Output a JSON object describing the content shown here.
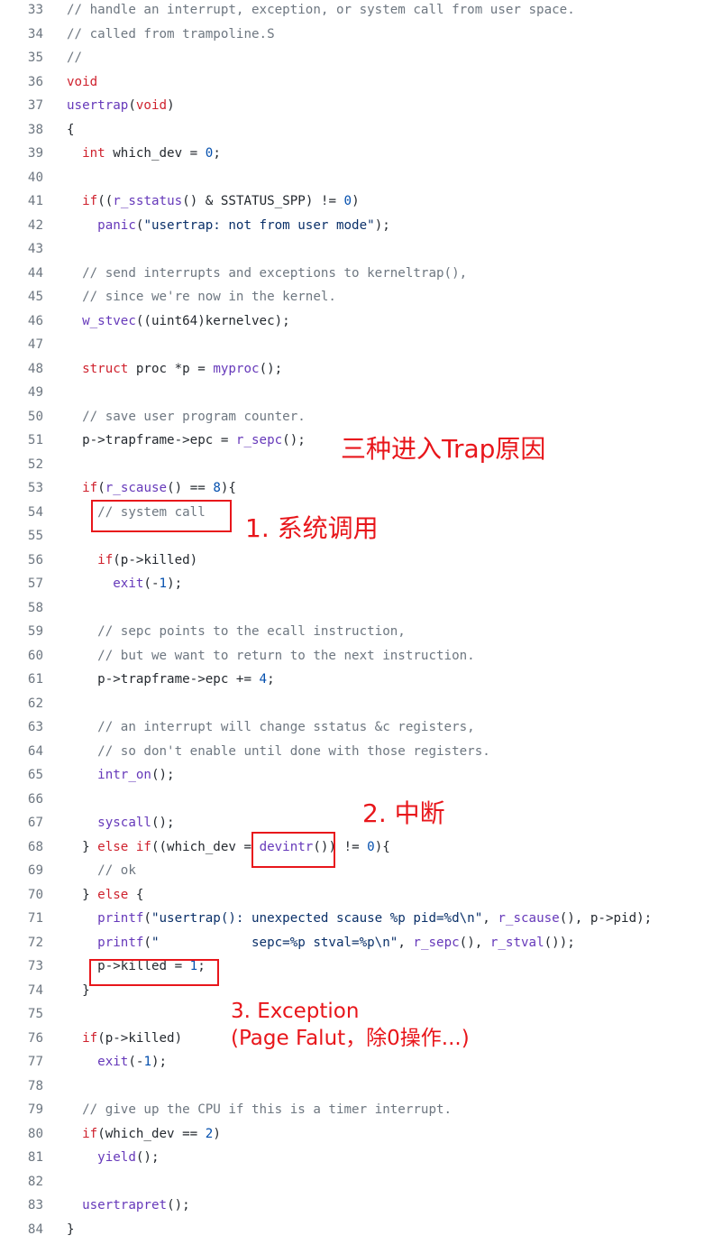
{
  "code": {
    "lines": [
      {
        "n": "33",
        "html": "<span class='cm'>// handle an interrupt, exception, or system call from user space.</span>"
      },
      {
        "n": "34",
        "html": "<span class='cm'>// called from trampoline.S</span>"
      },
      {
        "n": "35",
        "html": "<span class='cm'>//</span>"
      },
      {
        "n": "36",
        "html": "<span class='kw'>void</span>"
      },
      {
        "n": "37",
        "html": "<span class='fn'>usertrap</span>(<span class='kw'>void</span>)"
      },
      {
        "n": "38",
        "html": "{"
      },
      {
        "n": "39",
        "html": "  <span class='kw'>int</span> which_dev = <span class='nm'>0</span>;"
      },
      {
        "n": "40",
        "html": ""
      },
      {
        "n": "41",
        "html": "  <span class='kw'>if</span>((<span class='fn'>r_sstatus</span>() &amp; SSTATUS_SPP) != <span class='nm'>0</span>)"
      },
      {
        "n": "42",
        "html": "    <span class='fn'>panic</span>(<span class='st'>\"usertrap: not from user mode\"</span>);"
      },
      {
        "n": "43",
        "html": ""
      },
      {
        "n": "44",
        "html": "  <span class='cm'>// send interrupts and exceptions to kerneltrap(),</span>"
      },
      {
        "n": "45",
        "html": "  <span class='cm'>// since we're now in the kernel.</span>"
      },
      {
        "n": "46",
        "html": "  <span class='fn'>w_stvec</span>((uint64)kernelvec);"
      },
      {
        "n": "47",
        "html": ""
      },
      {
        "n": "48",
        "html": "  <span class='kw'>struct</span> proc *p = <span class='fn'>myproc</span>();"
      },
      {
        "n": "49",
        "html": ""
      },
      {
        "n": "50",
        "html": "  <span class='cm'>// save user program counter.</span>"
      },
      {
        "n": "51",
        "html": "  p-&gt;trapframe-&gt;epc = <span class='fn'>r_sepc</span>();"
      },
      {
        "n": "52",
        "html": ""
      },
      {
        "n": "53",
        "html": "  <span class='kw'>if</span>(<span class='fn'>r_scause</span>() == <span class='nm'>8</span>){"
      },
      {
        "n": "54",
        "html": "    <span class='cm'>// system call</span>"
      },
      {
        "n": "55",
        "html": ""
      },
      {
        "n": "56",
        "html": "    <span class='kw'>if</span>(p-&gt;killed)"
      },
      {
        "n": "57",
        "html": "      <span class='fn'>exit</span>(-<span class='nm'>1</span>);"
      },
      {
        "n": "58",
        "html": ""
      },
      {
        "n": "59",
        "html": "    <span class='cm'>// sepc points to the ecall instruction,</span>"
      },
      {
        "n": "60",
        "html": "    <span class='cm'>// but we want to return to the next instruction.</span>"
      },
      {
        "n": "61",
        "html": "    p-&gt;trapframe-&gt;epc += <span class='nm'>4</span>;"
      },
      {
        "n": "62",
        "html": ""
      },
      {
        "n": "63",
        "html": "    <span class='cm'>// an interrupt will change sstatus &amp;c registers,</span>"
      },
      {
        "n": "64",
        "html": "    <span class='cm'>// so don't enable until done with those registers.</span>"
      },
      {
        "n": "65",
        "html": "    <span class='fn'>intr_on</span>();"
      },
      {
        "n": "66",
        "html": ""
      },
      {
        "n": "67",
        "html": "    <span class='fn'>syscall</span>();"
      },
      {
        "n": "68",
        "html": "  } <span class='kw'>else if</span>((which_dev = <span class='fn'>devintr</span>()) != <span class='nm'>0</span>){"
      },
      {
        "n": "69",
        "html": "    <span class='cm'>// ok</span>"
      },
      {
        "n": "70",
        "html": "  } <span class='kw'>else</span> {"
      },
      {
        "n": "71",
        "html": "    <span class='fn'>printf</span>(<span class='st'>\"usertrap(): unexpected scause %p pid=%d\\n\"</span>, <span class='fn'>r_scause</span>(), p-&gt;pid);"
      },
      {
        "n": "72",
        "html": "    <span class='fn'>printf</span>(<span class='st'>\"            sepc=%p stval=%p\\n\"</span>, <span class='fn'>r_sepc</span>(), <span class='fn'>r_stval</span>());"
      },
      {
        "n": "73",
        "html": "    p-&gt;killed = <span class='nm'>1</span>;"
      },
      {
        "n": "74",
        "html": "  }"
      },
      {
        "n": "75",
        "html": ""
      },
      {
        "n": "76",
        "html": "  <span class='kw'>if</span>(p-&gt;killed)"
      },
      {
        "n": "77",
        "html": "    <span class='fn'>exit</span>(-<span class='nm'>1</span>);"
      },
      {
        "n": "78",
        "html": ""
      },
      {
        "n": "79",
        "html": "  <span class='cm'>// give up the CPU if this is a timer interrupt.</span>"
      },
      {
        "n": "80",
        "html": "  <span class='kw'>if</span>(which_dev == <span class='nm'>2</span>)"
      },
      {
        "n": "81",
        "html": "    <span class='fn'>yield</span>();"
      },
      {
        "n": "82",
        "html": ""
      },
      {
        "n": "83",
        "html": "  <span class='fn'>usertrapret</span>();"
      },
      {
        "n": "84",
        "html": "}"
      }
    ]
  },
  "annotations": {
    "title": "三种进入Trap原因",
    "syscall": "1. 系统调用",
    "interrupt": "2. 中断",
    "exception_line1": "3. Exception",
    "exception_line2": "(Page Falut，除0操作...)"
  },
  "colors": {
    "annotation_red": "#e8161b",
    "keyword": "#cf222e",
    "function": "#6639ba",
    "number": "#0550ae",
    "comment": "#6e7781",
    "string": "#0a3069",
    "text": "#24292f"
  }
}
